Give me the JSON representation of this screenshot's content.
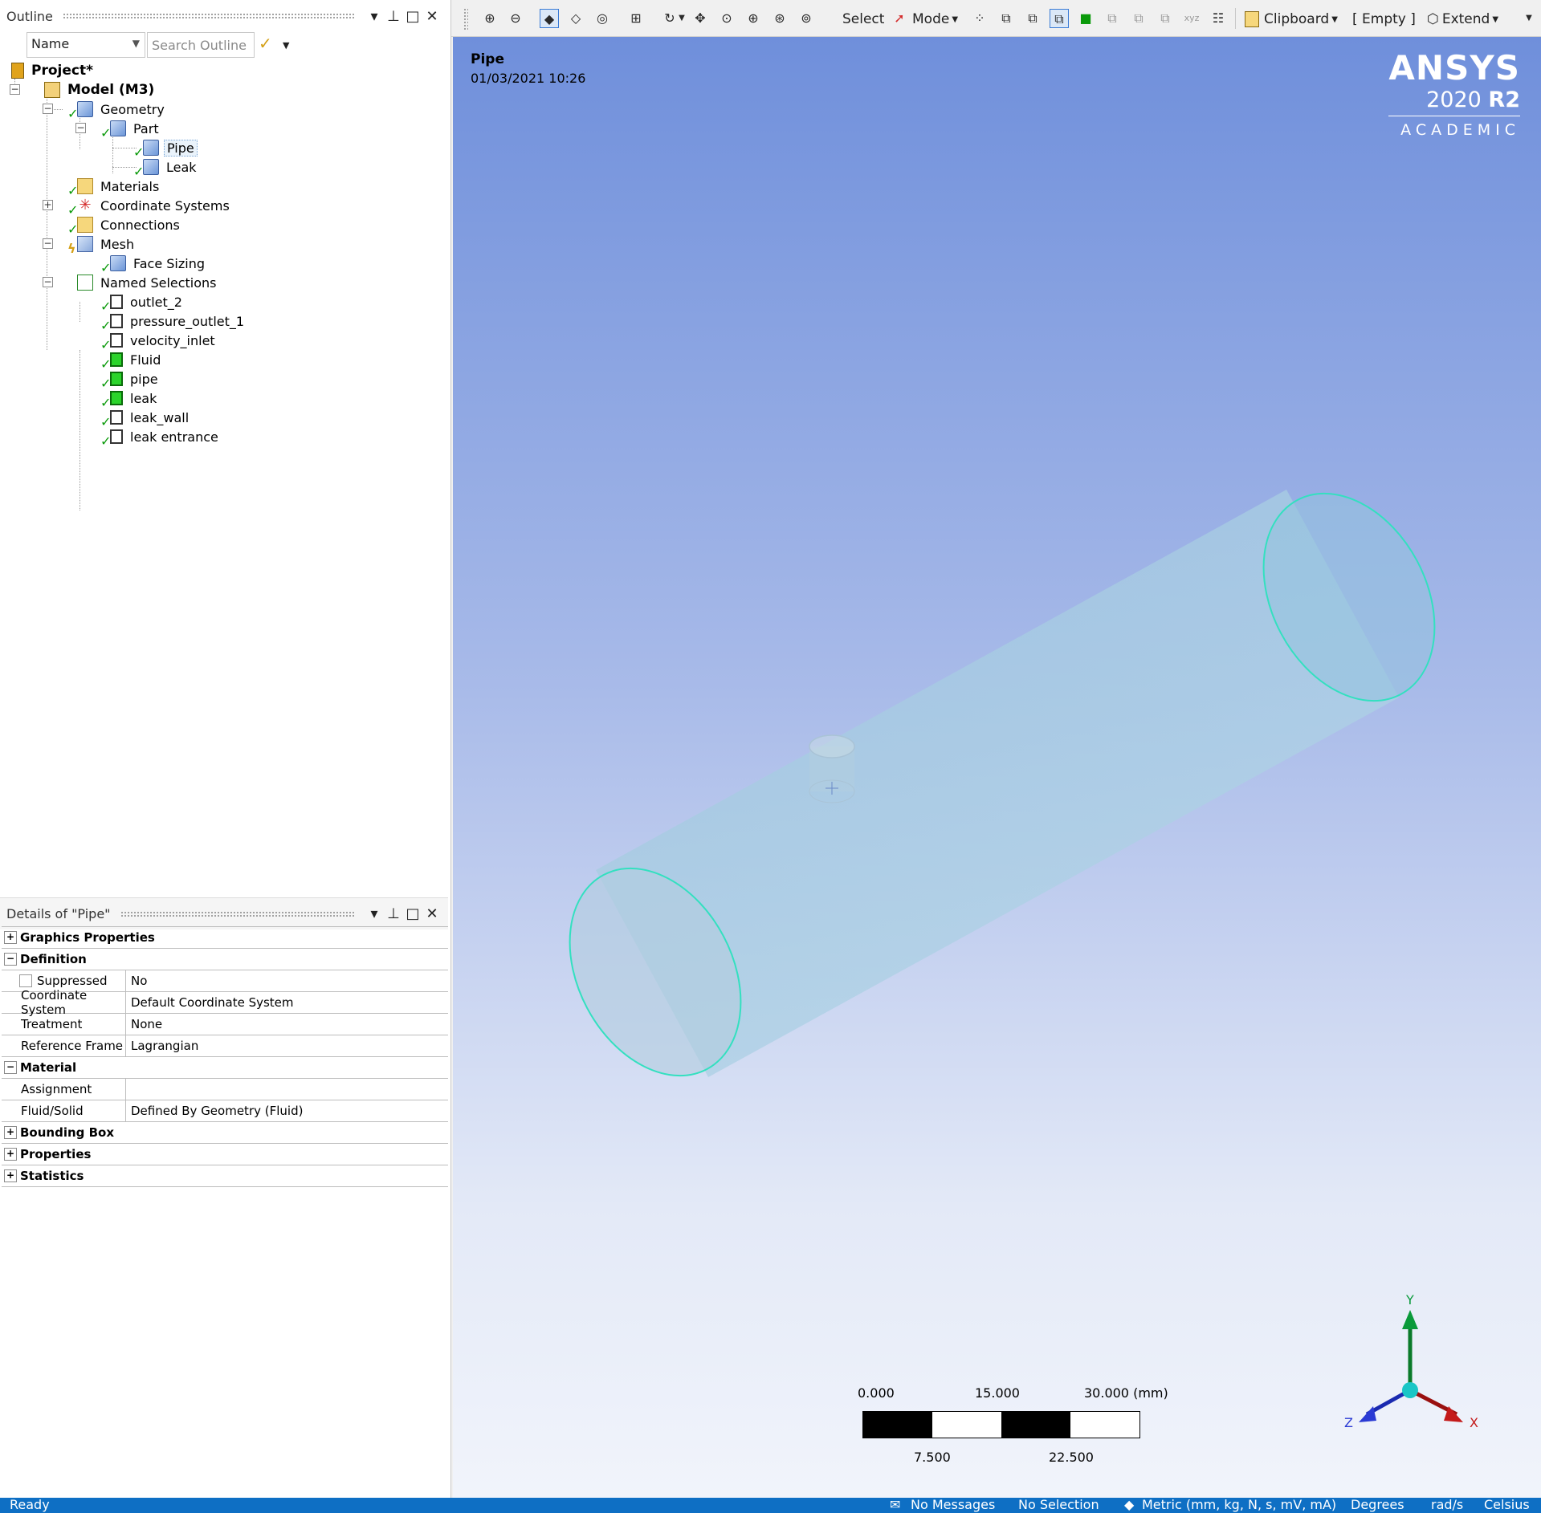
{
  "outline": {
    "title": "Outline",
    "name_select": "Name",
    "search_placeholder": "Search Outline",
    "tree": {
      "project": "Project*",
      "model": "Model (M3)",
      "geometry": "Geometry",
      "part": "Part",
      "pipe": "Pipe",
      "leak": "Leak",
      "materials": "Materials",
      "coordinate_systems": "Coordinate Systems",
      "connections": "Connections",
      "mesh": "Mesh",
      "face_sizing": "Face Sizing",
      "named_selections": "Named Selections",
      "ns_items": [
        {
          "label": "outlet_2",
          "icon": "ns-empty-icon"
        },
        {
          "label": "pressure_outlet_1",
          "icon": "ns-empty-icon"
        },
        {
          "label": "velocity_inlet",
          "icon": "ns-empty-icon"
        },
        {
          "label": "Fluid",
          "icon": "ns-green-icon"
        },
        {
          "label": "pipe",
          "icon": "ns-green-icon"
        },
        {
          "label": "leak",
          "icon": "ns-green-icon"
        },
        {
          "label": "leak_wall",
          "icon": "ns-empty-icon"
        },
        {
          "label": "leak entrance",
          "icon": "ns-empty-icon"
        }
      ]
    }
  },
  "details": {
    "title": "Details of \"Pipe\"",
    "categories": {
      "graphics": "Graphics Properties",
      "definition": "Definition",
      "material": "Material",
      "bounding_box": "Bounding Box",
      "properties": "Properties",
      "statistics": "Statistics"
    },
    "rows": {
      "suppressed": {
        "key": "Suppressed",
        "value": "No"
      },
      "coordinate_system": {
        "key": "Coordinate System",
        "value": "Default Coordinate System"
      },
      "treatment": {
        "key": "Treatment",
        "value": "None"
      },
      "reference_frame": {
        "key": "Reference Frame",
        "value": "Lagrangian"
      },
      "assignment": {
        "key": "Assignment",
        "value": ""
      },
      "fluid_solid": {
        "key": "Fluid/Solid",
        "value": "Defined By Geometry (Fluid)"
      }
    }
  },
  "toolbar": {
    "select": "Select",
    "mode": "Mode",
    "clipboard": "Clipboard",
    "empty": "[ Empty ]",
    "extend": "Extend"
  },
  "viewport": {
    "title": "Pipe",
    "date": "01/03/2021 10:26",
    "brand_name": "ANSYS",
    "brand_year": "2020",
    "brand_release": "R2",
    "brand_edition": "ACADEMIC",
    "scale": {
      "top_labels": [
        "0.000",
        "15.000",
        "30.000 (mm)"
      ],
      "bottom_labels": [
        "7.500",
        "22.500"
      ]
    },
    "triad": {
      "x": "X",
      "y": "Y",
      "z": "Z"
    },
    "colors": {
      "edge": "#33e0c0",
      "pipe_fill": "#a6cfe3",
      "bg_top": "#6f8fdb",
      "bg_bottom": "#f1f4fb"
    }
  },
  "status": {
    "ready": "Ready",
    "messages": "No Messages",
    "selection": "No Selection",
    "units": "Metric (mm, kg, N, s, mV, mA)",
    "angle": "Degrees",
    "rate": "rad/s",
    "temp": "Celsius"
  }
}
